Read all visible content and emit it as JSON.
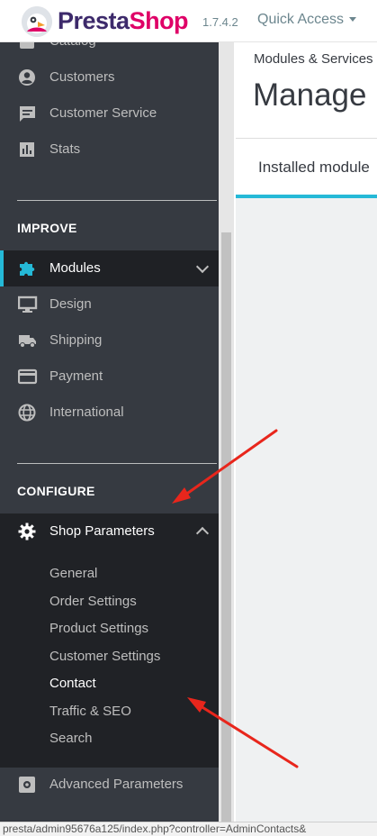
{
  "header": {
    "brand_a": "Presta",
    "brand_b": "Shop",
    "version": "1.7.4.2",
    "quick_access": "Quick Access"
  },
  "sidebar": {
    "top_items": [
      {
        "label": "Catalog",
        "icon": "catalog-icon"
      },
      {
        "label": "Customers",
        "icon": "account-circle-icon"
      },
      {
        "label": "Customer Service",
        "icon": "chat-icon"
      },
      {
        "label": "Stats",
        "icon": "bar-chart-icon"
      }
    ],
    "improve_title": "IMPROVE",
    "improve_items": [
      {
        "label": "Modules",
        "icon": "puzzle-icon"
      },
      {
        "label": "Design",
        "icon": "desktop-icon"
      },
      {
        "label": "Shipping",
        "icon": "truck-icon"
      },
      {
        "label": "Payment",
        "icon": "credit-card-icon"
      },
      {
        "label": "International",
        "icon": "globe-icon"
      }
    ],
    "configure_title": "CONFIGURE",
    "shop_parameters": "Shop Parameters",
    "shop_sub": [
      "General",
      "Order Settings",
      "Product Settings",
      "Customer Settings",
      "Contact",
      "Traffic & SEO",
      "Search"
    ],
    "advanced": "Advanced Parameters"
  },
  "main": {
    "breadcrumb": "Modules & Services",
    "title": "Manage i",
    "tab": "Installed module"
  },
  "status_url": "presta/admin95676a125/index.php?controller=AdminContacts&",
  "colors": {
    "sidebar_bg": "#363a41",
    "accent": "#25b9d7",
    "brand_pink": "#df0067",
    "arrow": "#e8261c"
  }
}
